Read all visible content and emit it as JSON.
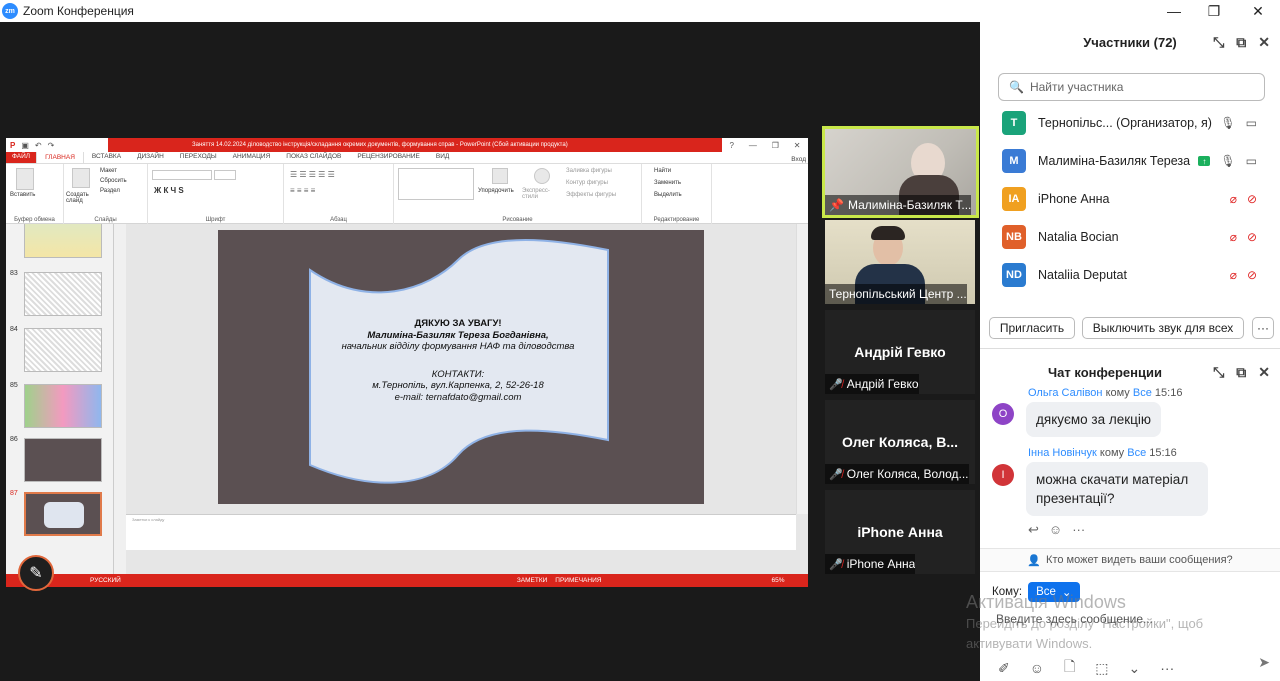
{
  "window": {
    "title": "Zoom Конференция",
    "app_icon_text": "zm",
    "controls": {
      "minimize": "—",
      "maximize": "❐",
      "close": "✕"
    }
  },
  "powerpoint": {
    "title_bar_text": "Заняття 14.02.2024 діловодство інструкція/складання окремих документів, формування справ - PowerPoint (Сбой активации продукта)",
    "tabs": [
      "ФАЙЛ",
      "ГЛАВНАЯ",
      "ВСТАВКА",
      "ДИЗАЙН",
      "ПЕРЕХОДЫ",
      "АНИМАЦИЯ",
      "ПОКАЗ СЛАЙДОВ",
      "РЕЦЕНЗИРОВАНИЕ",
      "ВИД"
    ],
    "sign_in": "Вход",
    "ribbon_groups": [
      "Буфер обмена",
      "Слайды",
      "Шрифт",
      "Абзац",
      "Рисование",
      "Редактирование"
    ],
    "ribbon_buttons": {
      "paste": "Вставить",
      "new_slide": "Создать слайд",
      "layout": "Макет",
      "reset": "Сбросить",
      "section": "Раздел",
      "arrange": "Упорядочить",
      "quick_styles": "Экспресс-стили",
      "shape_fill": "Заливка фигуры",
      "shape_outline": "Контур фигуры",
      "shape_effects": "Эффекты фигуры",
      "find": "Найти",
      "replace": "Заменить",
      "select": "Выделить"
    },
    "thumbnails": [
      "83",
      "84",
      "85",
      "86",
      "87"
    ],
    "slide": {
      "line1": "ДЯКУЮ ЗА УВАГУ!",
      "line2": "Малиміна-Базиляк Тереза Богданівна,",
      "line3": "начальник відділу формування НАФ та діловодства",
      "line4": "КОНТАКТИ:",
      "line5": "м.Тернопіль, вул.Карпенка, 2, 52-26-18",
      "line6": "e-mail: ternafdato@gmail.com"
    },
    "notes_placeholder": "Заметки к слайду",
    "status": {
      "language": "РУССКИЙ",
      "notes": "ЗАМЕТКИ",
      "comments": "ПРИМЕЧАНИЯ",
      "zoom": "65%"
    }
  },
  "video_tiles": [
    {
      "name": "Малиміна-Базиляк Т...",
      "type": "video"
    },
    {
      "name": "Тернопільський Центр ...",
      "type": "video"
    },
    {
      "big_name": "Андрій Гевко",
      "name": "Андрій Гевко",
      "type": "name"
    },
    {
      "big_name": "Олег Коляса, В...",
      "name": "Олег Коляса, Волод...",
      "type": "name"
    },
    {
      "big_name": "iPhone Анна",
      "name": "iPhone Анна",
      "type": "name"
    }
  ],
  "participants_panel": {
    "title": "Участники (72)",
    "search_placeholder": "Найти участника",
    "list": [
      {
        "initials": "T",
        "color": "#1aa37a",
        "name": "Тернопільс... (Организатор, я)",
        "mic": "on",
        "cam": "on"
      },
      {
        "initials": "M",
        "color": "#3a7bd5",
        "name": "Малиміна-Базиляк Тереза",
        "mic": "on",
        "cam": "on",
        "sharing": true
      },
      {
        "initials": "IA",
        "color": "#f0a020",
        "name": "iPhone Анна",
        "mic": "off",
        "cam": "off"
      },
      {
        "initials": "NB",
        "color": "#e0602a",
        "name": "Natalia Bocian",
        "mic": "off",
        "cam": "off"
      },
      {
        "initials": "ND",
        "color": "#2a7bd0",
        "name": "Nataliia Deputat",
        "mic": "off",
        "cam": "off"
      }
    ],
    "invite_button": "Пригласить",
    "mute_all_button": "Выключить звук для всех",
    "more_button": "···"
  },
  "chat_panel": {
    "title": "Чат конференции",
    "messages": [
      {
        "sender": "Ольга Салівон",
        "to": "кому",
        "target": "Все",
        "time": "15:16",
        "text": "дякуємо за лекцію",
        "avatar": "O",
        "avatar_color": "#8e44c6"
      },
      {
        "sender": "Інна Новінчук",
        "to": "кому",
        "target": "Все",
        "time": "15:16",
        "text": "можна скачати матеріал презентації?",
        "avatar": "I",
        "avatar_color": "#d13438"
      }
    ],
    "who_can_see": "Кто может видеть ваши сообщения?",
    "to_label": "Кому:",
    "to_value": "Все",
    "input_placeholder": "Введите здесь сообщение..."
  },
  "watermark": {
    "line1": "Активація Windows",
    "line2": "Перейдіть до розділу \"Настройки\", щоб",
    "line3": "активувати Windows."
  }
}
